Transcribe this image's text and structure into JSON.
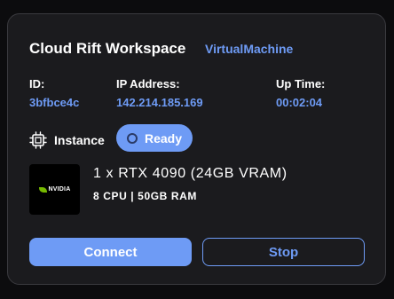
{
  "workspace": {
    "title": "Cloud Rift Workspace",
    "type": "VirtualMachine"
  },
  "details": {
    "id_label": "ID:",
    "id_value": "3bfbce4c",
    "ip_label": "IP Address:",
    "ip_value": "142.214.185.169",
    "uptime_label": "Up Time:",
    "uptime_value": "00:02:04"
  },
  "instance": {
    "label": "Instance",
    "status": "Ready",
    "icon": "cpu-chip-icon"
  },
  "hardware": {
    "logo_text": "NVIDIA",
    "gpu": "1 x RTX 4090 (24GB VRAM)",
    "spec": "8 CPU | 50GB RAM"
  },
  "actions": {
    "connect_label": "Connect",
    "stop_label": "Stop"
  },
  "colors": {
    "accent": "#6e9bf5",
    "card_bg": "#1b1b1e",
    "nvidia_green": "#76b900"
  }
}
